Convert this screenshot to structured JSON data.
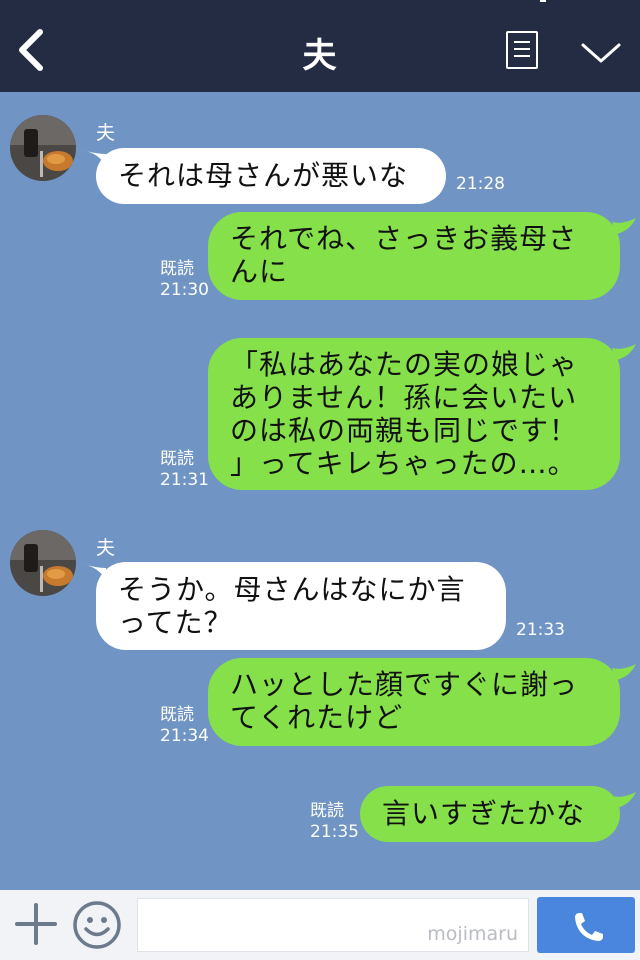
{
  "header": {
    "title": "夫",
    "back_icon": "chevron-left-icon",
    "menu_icon": "note-menu-icon",
    "collapse_icon": "chevron-down-icon"
  },
  "messages": [
    {
      "side": "in",
      "sender": "夫",
      "text": "それは母さんが悪いな",
      "time": "21:28"
    },
    {
      "side": "out",
      "read": "既読",
      "time": "21:30",
      "lines": [
        "それでね、さっきお義母さ",
        "んに"
      ]
    },
    {
      "side": "out",
      "read": "既読",
      "time": "21:31",
      "lines": [
        "「私はあなたの実の娘じゃ",
        "ありません！孫に会いたい",
        "のは私の両親も同じです！",
        "」ってキレちゃったの…。"
      ]
    },
    {
      "side": "in",
      "sender": "夫",
      "time": "21:33",
      "lines": [
        "そうか。母さんはなにか言",
        "ってた？"
      ]
    },
    {
      "side": "out",
      "read": "既読",
      "time": "21:34",
      "lines": [
        "ハッとした顔ですぐに謝っ",
        "てくれたけど"
      ]
    },
    {
      "side": "out",
      "read": "既読",
      "time": "21:35",
      "text": "言いすぎたかな"
    }
  ],
  "footer": {
    "watermark": "mojimaru",
    "input_placeholder": "",
    "plus_icon": "plus-icon",
    "sticker_icon": "smiley-icon",
    "call_icon": "phone-icon"
  },
  "colors": {
    "header_bg": "#232c42",
    "chat_bg": "#7094c4",
    "outgoing_bubble": "#86e049",
    "incoming_bubble": "#ffffff",
    "call_button": "#4a86dd"
  }
}
